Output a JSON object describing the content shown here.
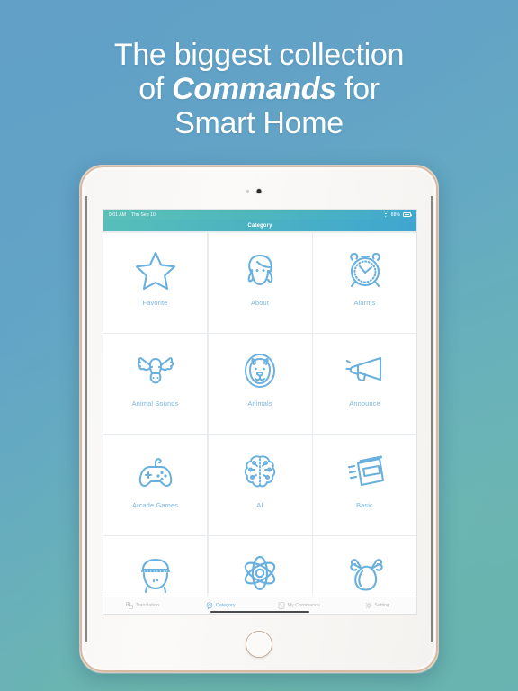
{
  "headline": {
    "line1": "The biggest collection",
    "line2_a": "of ",
    "line2_b": "Commands",
    "line2_c": " for",
    "line3": "Smart Home"
  },
  "colors": {
    "bg_top": "#63a1c6",
    "bg_bottom": "#6bb6ac",
    "accent_icon": "#6ab0de",
    "accent_label": "#79b6de",
    "nav_gradient_start": "#57bfb9",
    "nav_gradient_end": "#40a6d0",
    "tab_inactive": "#b3b7bb",
    "tab_active": "#6ab0de",
    "bezel_gold": "#d9bba3"
  },
  "device": {
    "camera": "front-camera",
    "home_button": "home-button"
  },
  "statusbar": {
    "time": "9:01 AM",
    "date": "Thu Sep 10",
    "wifi": "wifi-icon",
    "battery_pct": "88%",
    "battery": "battery-icon"
  },
  "navbar": {
    "title": "Category"
  },
  "grid": {
    "tiles": [
      {
        "label": "Favorite",
        "icon": "star-icon"
      },
      {
        "label": "About",
        "icon": "woman-face-icon"
      },
      {
        "label": "Alarms",
        "icon": "alarm-clock-icon"
      },
      {
        "label": "Animal Sounds",
        "icon": "moose-head-icon"
      },
      {
        "label": "Animals",
        "icon": "lion-head-icon"
      },
      {
        "label": "Announce",
        "icon": "megaphone-icon"
      },
      {
        "label": "Arcade Games",
        "icon": "gamepad-icon"
      },
      {
        "label": "AI",
        "icon": "brain-circuit-icon"
      },
      {
        "label": "Basic",
        "icon": "notepad-icon"
      },
      {
        "label": "",
        "icon": "cooking-pot-icon"
      },
      {
        "label": "",
        "icon": "atom-icon"
      },
      {
        "label": "",
        "icon": "chicken-legs-icon"
      }
    ]
  },
  "tabbar": {
    "tabs": [
      {
        "label": "Translation",
        "icon": "translate-icon",
        "active": false
      },
      {
        "label": "Category",
        "icon": "category-icon",
        "active": true
      },
      {
        "label": "My Commands",
        "icon": "my-commands-icon",
        "active": false
      },
      {
        "label": "Setting",
        "icon": "gear-icon",
        "active": false
      }
    ]
  }
}
